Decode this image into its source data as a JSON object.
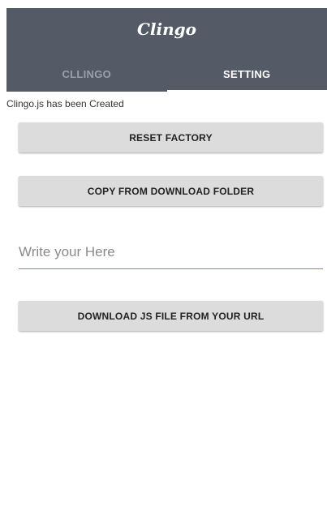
{
  "app": {
    "title": "Clingo"
  },
  "tabs": [
    {
      "label": "CLLINGO",
      "active": false
    },
    {
      "label": "SETTING",
      "active": true
    }
  ],
  "status": {
    "message": "Clingo.js has been Created"
  },
  "buttons": {
    "reset_label": "RESET FACTORY",
    "copy_label": "COPY FROM DOWNLOAD FOLDER",
    "download_label": "DOWNLOAD JS FILE FROM YOUR URL"
  },
  "url_input": {
    "placeholder": "Write your Here",
    "value": ""
  },
  "colors": {
    "appbar": "#545a66",
    "button": "#dcdcdc",
    "input_underline": "#7d8bb3"
  }
}
